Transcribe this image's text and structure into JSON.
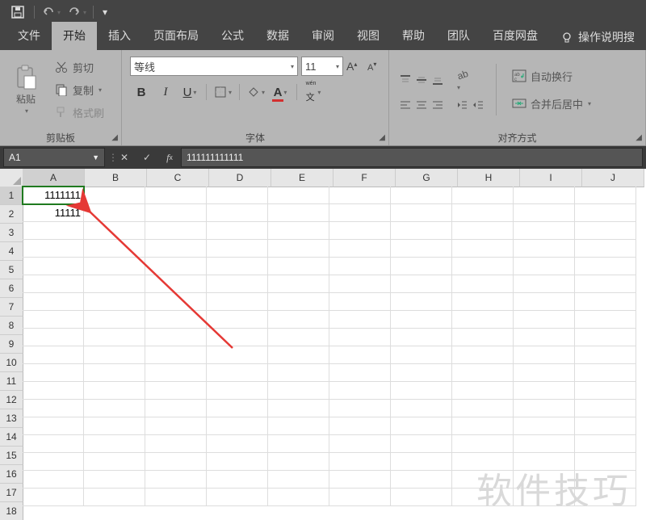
{
  "qat": {
    "save": "save-icon",
    "undo": "undo-icon",
    "redo": "redo-icon"
  },
  "tabs": {
    "items": [
      "文件",
      "开始",
      "插入",
      "页面布局",
      "公式",
      "数据",
      "审阅",
      "视图",
      "帮助",
      "团队",
      "百度网盘"
    ],
    "active_index": 1,
    "help_hint": "操作说明搜"
  },
  "ribbon": {
    "clipboard": {
      "paste": "粘贴",
      "cut": "剪切",
      "copy": "复制",
      "format_painter": "格式刷",
      "group_label": "剪贴板"
    },
    "font": {
      "name": "等线",
      "size": "11",
      "group_label": "字体"
    },
    "alignment": {
      "wrap": "自动换行",
      "merge": "合并后居中",
      "group_label": "对齐方式"
    }
  },
  "formula_bar": {
    "cell_ref": "A1",
    "formula": "111111111111"
  },
  "grid": {
    "columns": [
      "A",
      "B",
      "C",
      "D",
      "E",
      "F",
      "G",
      "H",
      "I",
      "J"
    ],
    "rows": 18,
    "selected_col": 0,
    "selected_row": 0,
    "cells": {
      "A1": "1111111",
      "A2": "11111"
    }
  },
  "watermark": "软件技巧"
}
